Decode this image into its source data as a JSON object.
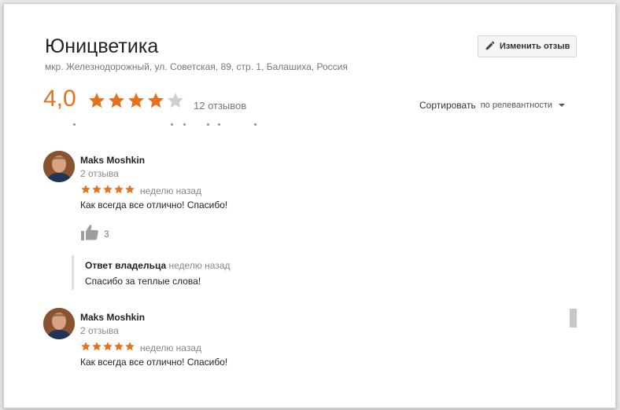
{
  "place": {
    "title": "Юницветика",
    "address": "мкр. Железнодорожный, ул. Советская, 89, стр. 1, Балашиха, Россия",
    "rating": "4,0",
    "rating_value": 4,
    "review_count": "12 отзывов"
  },
  "toolbar": {
    "edit_label": "Изменить отзыв",
    "edit_icon": "pencil-icon"
  },
  "sort": {
    "label": "Сортировать",
    "value": "по релевантности"
  },
  "colors": {
    "accent": "#e7711b",
    "star_empty": "#cfcfcf"
  },
  "reviews": [
    {
      "author": "Maks Moshkin",
      "author_reviews": "2 отзыва",
      "stars": 5,
      "when": "неделю назад",
      "text": "Как всегда все отлично! Спасибо!",
      "likes": "3",
      "owner_reply": {
        "label": "Ответ владельца",
        "when": "неделю назад",
        "text": "Спасибо за теплые слова!"
      }
    },
    {
      "author": "Maks Moshkin",
      "author_reviews": "2 отзыва",
      "stars": 5,
      "when": "неделю назад",
      "text": "Как всегда все отлично! Спасибо!"
    }
  ]
}
